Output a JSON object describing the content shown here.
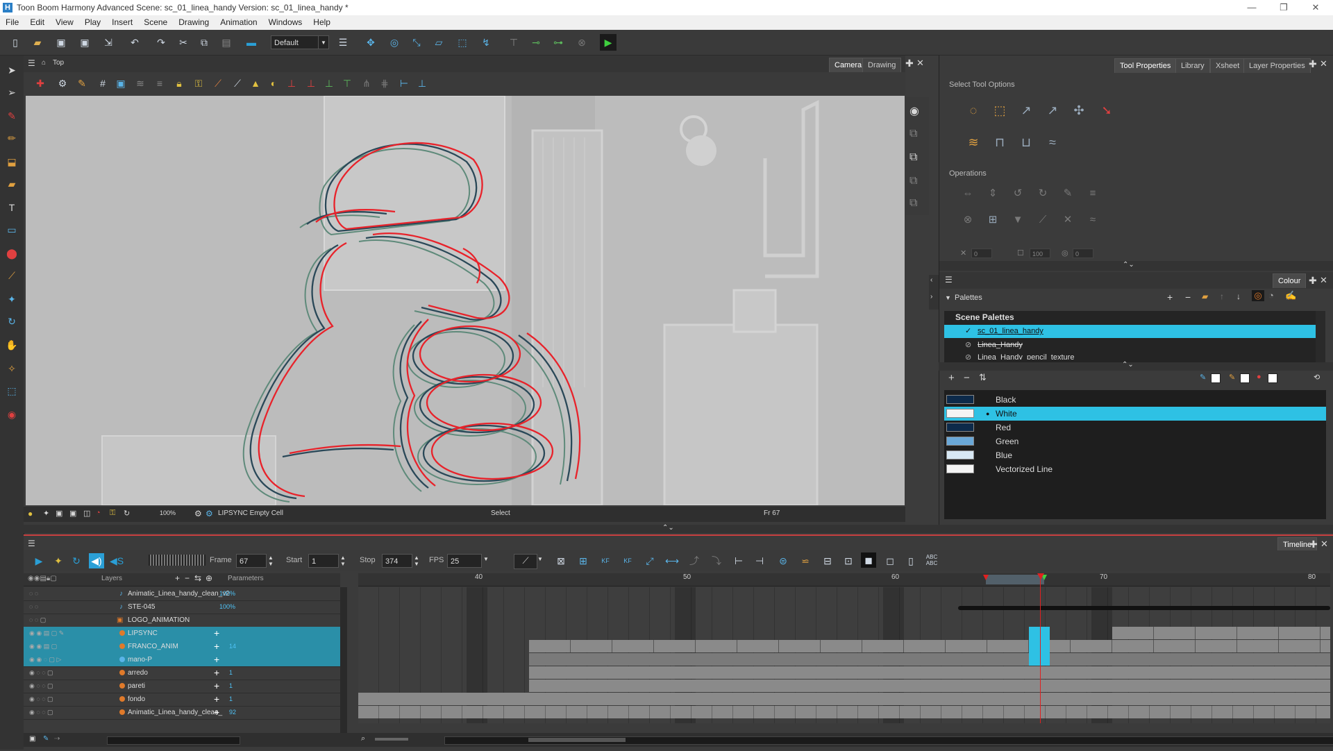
{
  "window": {
    "title": "Toon Boom Harmony Advanced Scene: sc_01_linea_handy Version: sc_01_linea_handy *",
    "logo": "H",
    "controls": [
      "minimize-icon",
      "restore-icon",
      "close-icon"
    ]
  },
  "menu": [
    "File",
    "Edit",
    "View",
    "Play",
    "Insert",
    "Scene",
    "Drawing",
    "Animation",
    "Windows",
    "Help"
  ],
  "toolbar": {
    "workspace_select": "Default"
  },
  "view": {
    "breadcrumb": "Top",
    "tabs": [
      "Camera",
      "Drawing"
    ],
    "active_tab": "Camera",
    "zoom": "100%",
    "current_layer": "LIPSYNC Empty Cell",
    "tool": "Select",
    "frame_label": "Fr 67"
  },
  "right_panel": {
    "tabs": [
      "Tool Properties",
      "Library",
      "Xsheet",
      "Layer Properties"
    ],
    "active_tab": "Tool Properties",
    "select_tool_options": "Select Tool Options",
    "operations": "Operations",
    "fields": [
      "0",
      "100",
      "0"
    ]
  },
  "colour_panel": {
    "tab": "Colour",
    "palettes_label": "Palettes",
    "scene_palettes_label": "Scene Palettes",
    "palettes": [
      {
        "name": "sc_01_linea_handy",
        "selected": true
      },
      {
        "name": "Linea_Handy",
        "selected": false
      },
      {
        "name": "Linea_Handy_pencil_texture",
        "selected": false
      }
    ],
    "colours": [
      {
        "name": "Black",
        "swatch": "#0d2a4a",
        "selected": false
      },
      {
        "name": "White",
        "swatch": "#f4f4f4",
        "selected": true
      },
      {
        "name": "Red",
        "swatch": "#0d2a4a",
        "selected": false
      },
      {
        "name": "Green",
        "swatch": "#6aa8d8",
        "selected": false
      },
      {
        "name": "Blue",
        "swatch": "#d8e8f4",
        "selected": false
      },
      {
        "name": "Vectorized Line",
        "swatch": "#f4f4f4",
        "selected": false
      }
    ]
  },
  "timeline": {
    "tab": "Timeline",
    "frame_label": "Frame",
    "frame": "67",
    "start_label": "Start",
    "start": "1",
    "stop_label": "Stop",
    "stop": "374",
    "fps_label": "FPS",
    "fps": "25",
    "layers_header": "Layers",
    "params_header": "Parameters",
    "ruler": [
      "40",
      "50",
      "60",
      "70",
      "80"
    ],
    "layers": [
      {
        "name": "Animatic_Linea_handy_clean_v2",
        "param": "100%",
        "selected": false
      },
      {
        "name": "STE-045",
        "param": "100%",
        "selected": false
      },
      {
        "name": "LOGO_ANIMATION",
        "param": "",
        "selected": false
      },
      {
        "name": "LIPSYNC",
        "param": "",
        "selected": true
      },
      {
        "name": "FRANCO_ANIM",
        "param": "14",
        "selected": true
      },
      {
        "name": "mano-P",
        "param": "",
        "selected": true
      },
      {
        "name": "arredo",
        "param": "1",
        "selected": false
      },
      {
        "name": "pareti",
        "param": "1",
        "selected": false
      },
      {
        "name": "fondo",
        "param": "1",
        "selected": false
      },
      {
        "name": "Animatic_Linea_handy_clean_",
        "param": "92",
        "selected": false
      }
    ]
  }
}
